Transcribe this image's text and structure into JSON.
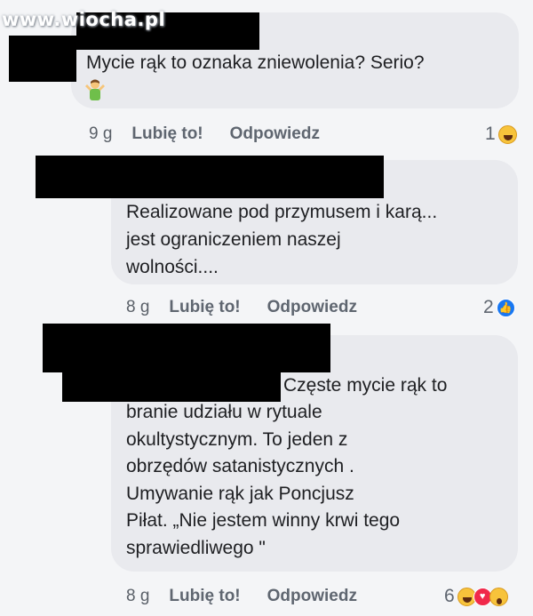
{
  "watermark": "www.wiocha.pl",
  "comments": [
    {
      "text": "Mycie rąk to oznaka zniewolenia? Serio?",
      "emoji": "person-shrugging-emoji",
      "time": "9 g",
      "like_label": "Lubię to!",
      "reply_label": "Odpowiedz",
      "reaction_count": "1",
      "reactions": [
        "haha-reaction-icon"
      ]
    },
    {
      "text": "Realizowane pod przymusem i karą...\njest ograniczeniem naszej\nwolności....",
      "time": "8 g",
      "like_label": "Lubię to!",
      "reply_label": "Odpowiedz",
      "reaction_count": "2",
      "reactions": [
        "like-reaction-icon"
      ]
    },
    {
      "text_first_line": "Częste mycie rąk to",
      "text": "branie udziału w rytuale\nokultystycznym. To jeden z\nobrzędów satanistycznych .\nUmywanie rąk jak Poncjusz\nPiłat. „Nie jestem winny krwi tego\nsprawiedliwego \"",
      "time": "8 g",
      "like_label": "Lubię to!",
      "reply_label": "Odpowiedz",
      "reaction_count": "6",
      "reactions": [
        "haha-reaction-icon",
        "love-reaction-icon",
        "wow-reaction-icon"
      ]
    }
  ],
  "colors": {
    "bubble": "#e9eaee",
    "text": "#1e1f22",
    "meta": "#5f6670",
    "like_blue": "#1877f2",
    "love_red": "#f0284a",
    "haha_yellow": "#f7c33b"
  }
}
